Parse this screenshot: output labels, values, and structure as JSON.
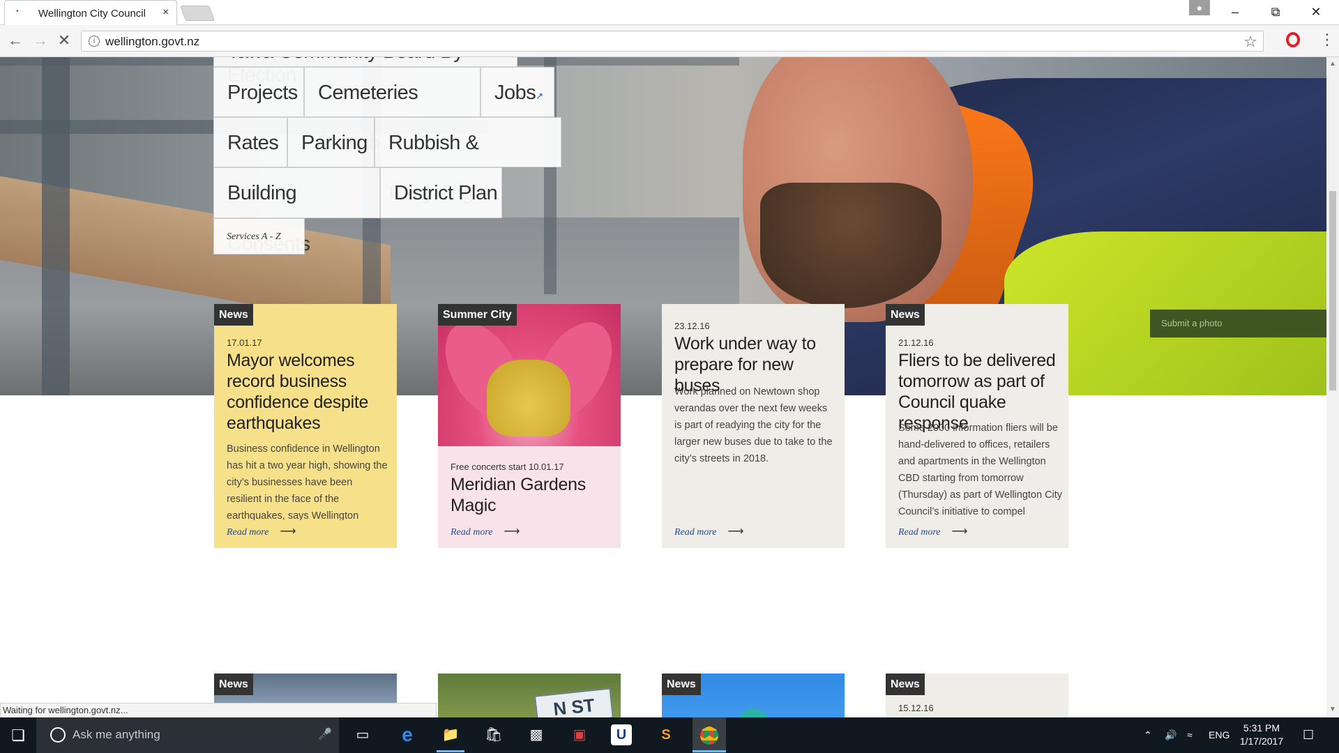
{
  "browser": {
    "tab_title": "Wellington City Council",
    "tab_close": "×",
    "url": "wellington.govt.nz",
    "status": "Waiting for wellington.govt.nz..."
  },
  "hero": {
    "partial_heading": "Tawa Community Board By-Election",
    "submit_photo": "Submit a photo"
  },
  "quick_links": [
    {
      "label": "Projects"
    },
    {
      "label": "Cemeteries Search"
    },
    {
      "label": "Jobs",
      "external": true
    },
    {
      "label": "Rates"
    },
    {
      "label": "Parking"
    },
    {
      "label": "Rubbish & Recycling"
    },
    {
      "label": "Building Consents"
    },
    {
      "label": "District Plan"
    },
    {
      "label": "Services A - Z"
    }
  ],
  "cards": [
    {
      "tag": "News",
      "date": "17.01.17",
      "title": "Mayor welcomes record business confidence despite earthquakes",
      "body": "Business confidence in Wellington has hit a two year high, showing the city’s businesses have been resilient in the face of the earthquakes, says Wellington",
      "read_more": "Read more",
      "bg": "#f6e08a"
    },
    {
      "tag": "Summer City",
      "date": "Free concerts start 10.01.17",
      "title": "Meridian Gardens Magic",
      "read_more": "Read more",
      "bg": "#f9e3ea"
    },
    {
      "date": "23.12.16",
      "title": "Work under way to prepare for new buses",
      "body": "Work planned on Newtown shop verandas over the next few weeks is part of readying the city for the larger new buses due to take to the city’s streets in 2018.",
      "read_more": "Read more",
      "bg": "#efede7"
    },
    {
      "tag": "News",
      "date": "21.12.16",
      "title": "Fliers to be delivered tomorrow as part of Council quake response",
      "body": "Some 2000 information fliers will be hand-delivered to offices, retailers and apartments in the Wellington CBD starting from tomorrow (Thursday) as part of Wellington City Council’s initiative to compel",
      "read_more": "Read more",
      "bg": "#efede7"
    }
  ],
  "bottom_cards": [
    {
      "tag": "News"
    },
    {
      "street_sign": "N ST"
    },
    {
      "tag": "News"
    },
    {
      "tag": "News",
      "date": "15.12.16"
    }
  ],
  "taskbar": {
    "search_placeholder": "Ask me anything",
    "language": "ENG",
    "time": "5:31 PM",
    "date": "1/17/2017"
  },
  "icons": [
    "page-favicon",
    "back-arrow-icon",
    "forward-arrow-icon",
    "stop-loading-icon",
    "info-icon",
    "star-icon",
    "opera-icon",
    "menu-icon",
    "windows-start-icon",
    "cortana-icon",
    "microphone-icon",
    "task-view-icon",
    "edge-icon",
    "file-explorer-icon",
    "store-icon",
    "terminal-icon",
    "app-icon",
    "u-app-icon",
    "sublime-icon",
    "chrome-icon",
    "chevron-up-icon",
    "volume-icon",
    "wifi-icon",
    "notifications-icon"
  ]
}
